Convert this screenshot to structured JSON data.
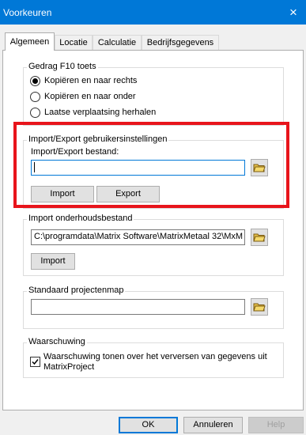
{
  "window": {
    "title": "Voorkeuren",
    "close_glyph": "×"
  },
  "tabs": [
    {
      "label": "Algemeen",
      "active": true
    },
    {
      "label": "Locatie",
      "active": false
    },
    {
      "label": "Calculatie",
      "active": false
    },
    {
      "label": "Bedrijfsgegevens",
      "active": false
    }
  ],
  "f10_group": {
    "title": "Gedrag F10 toets",
    "options": [
      {
        "label": "Kopiëren en naar rechts",
        "selected": true
      },
      {
        "label": "Kopiëren en naar onder",
        "selected": false
      },
      {
        "label": "Laatse verplaatsing herhalen",
        "selected": false
      }
    ]
  },
  "import_export_group": {
    "title": "Import/Export gebruikersinstellingen",
    "file_label": "Import/Export bestand:",
    "file_value": "",
    "import_label": "Import",
    "export_label": "Export"
  },
  "maintenance_group": {
    "title": "Import onderhoudsbestand",
    "path_value": "C:\\programdata\\Matrix Software\\MatrixMetaal 32\\MxM",
    "import_label": "Import"
  },
  "project_group": {
    "title": "Standaard projectenmap",
    "path_value": ""
  },
  "warning_group": {
    "title": "Waarschuwing",
    "checkbox_label_line1": "Waarschuwing tonen over het verversen van gegevens uit",
    "checkbox_label_line2": "MatrixProject",
    "checked": true
  },
  "footer": {
    "ok_label": "OK",
    "cancel_label": "Annuleren",
    "help_label": "Help"
  },
  "colors": {
    "titlebar": "#0078d7",
    "highlight": "#e8141b"
  },
  "icons": [
    "close-icon",
    "folder-icon",
    "checkmark-icon"
  ]
}
